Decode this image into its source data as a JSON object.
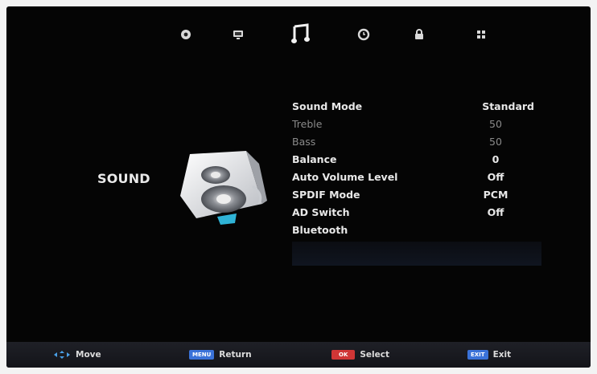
{
  "tabs": [
    {
      "icon": "picture-icon"
    },
    {
      "icon": "display-icon"
    },
    {
      "icon": "music-note-icon"
    },
    {
      "icon": "clock-icon"
    },
    {
      "icon": "lock-icon"
    },
    {
      "icon": "grid-icon"
    }
  ],
  "section": {
    "label": "SOUND"
  },
  "menu": {
    "items": [
      {
        "label": "Sound Mode",
        "value": "Standard"
      },
      {
        "label": "Treble",
        "value": "50"
      },
      {
        "label": "Bass",
        "value": "50"
      },
      {
        "label": "Balance",
        "value": "0"
      },
      {
        "label": "Auto Volume Level",
        "value": "Off"
      },
      {
        "label": "SPDIF Mode",
        "value": "PCM"
      },
      {
        "label": "AD Switch",
        "value": "Off"
      },
      {
        "label": "Bluetooth",
        "value": ""
      }
    ]
  },
  "help": {
    "move": {
      "label": "Move"
    },
    "return": {
      "key": "MENU",
      "label": "Return"
    },
    "select": {
      "key": "OK",
      "label": "Select"
    },
    "exit": {
      "key": "EXIT",
      "label": "Exit"
    }
  },
  "colors": {
    "accent_blue": "#3a72d8",
    "screen_bg": "#050505",
    "text": "#e8e8e8",
    "disabled_text": "#8a8a8a"
  }
}
